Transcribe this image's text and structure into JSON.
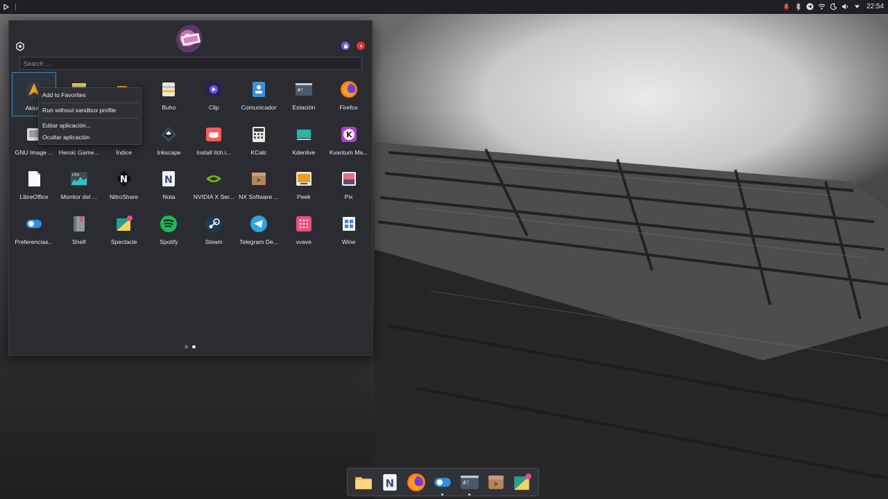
{
  "panel": {
    "clock": "22:54",
    "tray_icons": [
      "notification-bell-icon",
      "bluetooth-icon",
      "telegram-tray-icon",
      "wifi-icon",
      "night-light-icon",
      "volume-icon",
      "menu-arrow-icon"
    ]
  },
  "launcher": {
    "search_placeholder": "Search ...",
    "accent_color": "#3f8fc2",
    "apps": [
      {
        "label": "Akira (",
        "icon": "akira",
        "selected": true
      },
      {
        "label": "",
        "icon": "archive"
      },
      {
        "label": "",
        "icon": "audio"
      },
      {
        "label": "Buho",
        "icon": "buho"
      },
      {
        "label": "Clip",
        "icon": "clip"
      },
      {
        "label": "Comunicador",
        "icon": "comunicador"
      },
      {
        "label": "Estación",
        "icon": "estacion"
      },
      {
        "label": "Firefox",
        "icon": "firefox"
      },
      {
        "label": "GNU Image ...",
        "icon": "gimp"
      },
      {
        "label": "Heroic Game...",
        "icon": "heroic"
      },
      {
        "label": "Índice",
        "icon": "indice"
      },
      {
        "label": "Inkscape",
        "icon": "inkscape"
      },
      {
        "label": "Install itch.i...",
        "icon": "itch"
      },
      {
        "label": "KCalc",
        "icon": "kcalc"
      },
      {
        "label": "Kdenlive",
        "icon": "kdenlive"
      },
      {
        "label": "Kvantum Ma...",
        "icon": "kvantum"
      },
      {
        "label": "LibreOffice",
        "icon": "libreoffice"
      },
      {
        "label": "Monitor del ...",
        "icon": "monitor"
      },
      {
        "label": "NitroShare",
        "icon": "nitroshare"
      },
      {
        "label": "Nota",
        "icon": "nota"
      },
      {
        "label": "NVIDIA X Ser...",
        "icon": "nvidia"
      },
      {
        "label": "NX Software ...",
        "icon": "nxsoftware"
      },
      {
        "label": "Peek",
        "icon": "peek"
      },
      {
        "label": "Pix",
        "icon": "pix"
      },
      {
        "label": "Preferencias...",
        "icon": "preferencias"
      },
      {
        "label": "Shelf",
        "icon": "shelf"
      },
      {
        "label": "Spectacle",
        "icon": "spectacle"
      },
      {
        "label": "Spotify",
        "icon": "spotify"
      },
      {
        "label": "Steam",
        "icon": "steam"
      },
      {
        "label": "Telegram De...",
        "icon": "telegram"
      },
      {
        "label": "vvave",
        "icon": "vvave"
      },
      {
        "label": "Wine",
        "icon": "wine"
      }
    ],
    "pages": 2,
    "active_page": 2
  },
  "context_menu": {
    "items": [
      "Add to Favorites",
      "Run without sandbox profile",
      "Editar aplicación...",
      "Ocultar aplicación"
    ]
  },
  "dock": {
    "items": [
      {
        "icon": "files",
        "name": "dock-files",
        "running": false
      },
      {
        "icon": "nota",
        "name": "dock-nota",
        "running": false
      },
      {
        "icon": "firefox",
        "name": "dock-firefox",
        "running": false
      },
      {
        "icon": "preferencias",
        "name": "dock-preferencias",
        "running": true
      },
      {
        "icon": "estacion",
        "name": "dock-estacion",
        "running": true
      },
      {
        "icon": "nxsoftware",
        "name": "dock-nx-software",
        "running": false
      },
      {
        "icon": "spectacle",
        "name": "dock-spectacle",
        "running": false
      }
    ]
  }
}
